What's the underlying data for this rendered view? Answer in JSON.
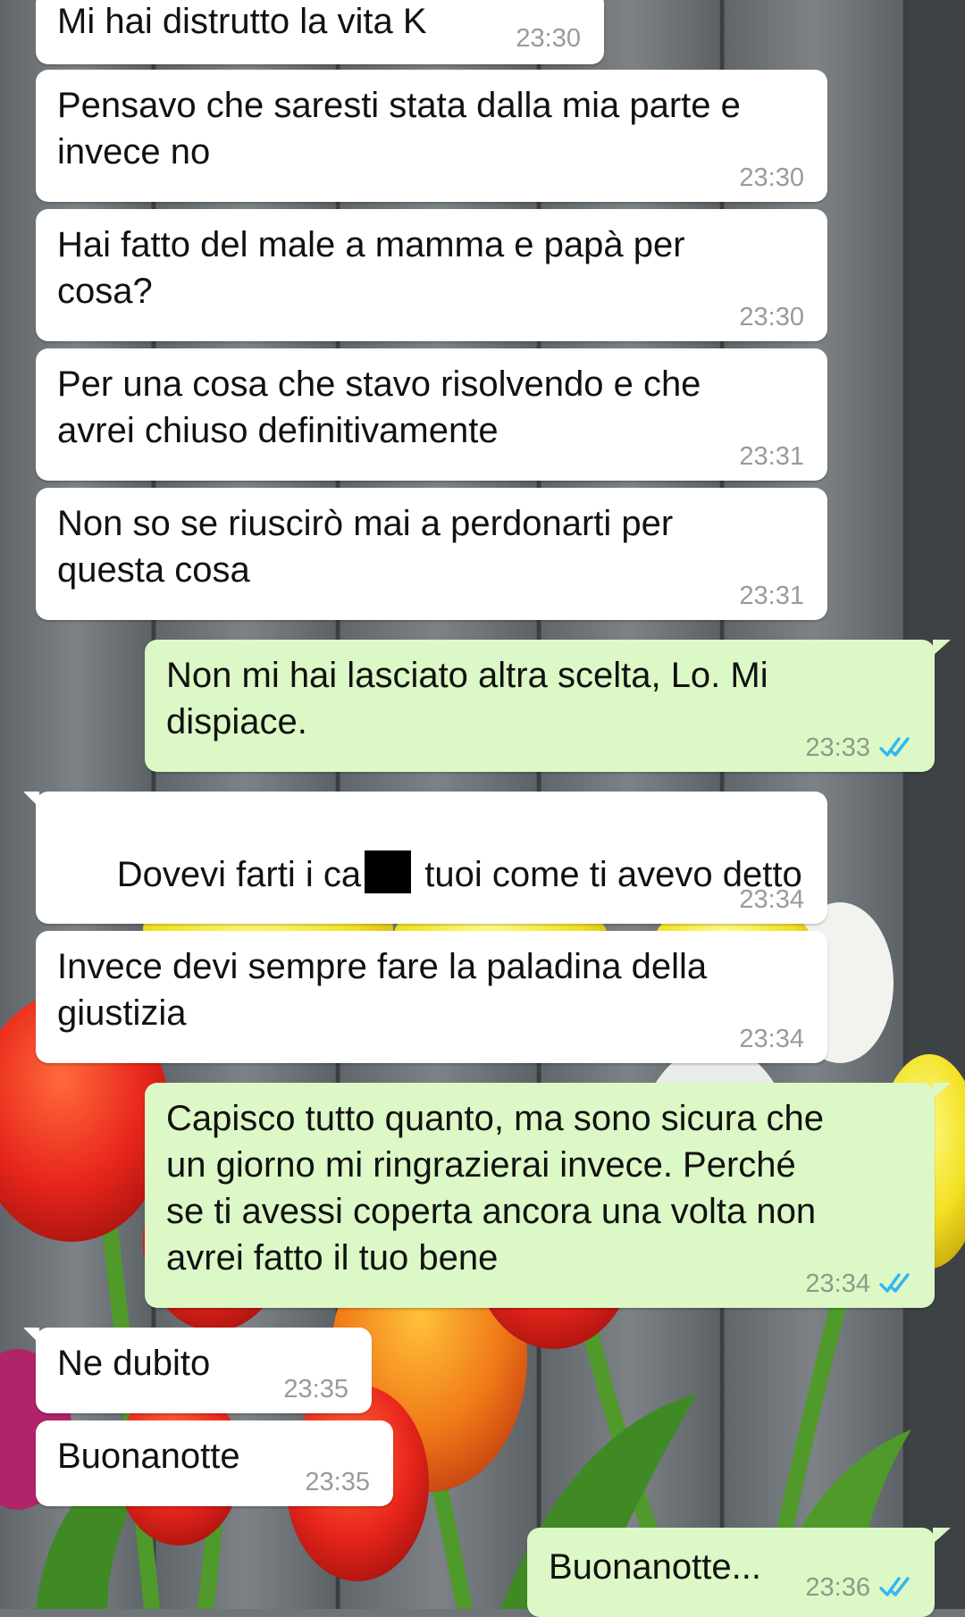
{
  "colors": {
    "incoming_bubble": "#ffffff",
    "outgoing_bubble": "#dcf8c6",
    "timestamp": "#9a9a9a",
    "read_ticks": "#34b7f1"
  },
  "messages": [
    {
      "dir": "in",
      "text": "Mi hai distrutto la vita K",
      "time": "23:30"
    },
    {
      "dir": "in",
      "text": "Pensavo che saresti stata dalla mia parte e\ninvece no",
      "time": "23:30"
    },
    {
      "dir": "in",
      "text": "Hai fatto del male a mamma e papà per\ncosa?",
      "time": "23:30"
    },
    {
      "dir": "in",
      "text": "Per una cosa che stavo risolvendo e che\navrei chiuso definitivamente",
      "time": "23:31"
    },
    {
      "dir": "in",
      "text": "Non so se riuscirò mai a perdonarti per\nquesta cosa",
      "time": "23:31"
    },
    {
      "dir": "out",
      "text": "Non mi hai lasciato altra scelta, Lo. Mi\ndispiace.",
      "time": "23:33",
      "status_icon": "double-check-read-icon"
    },
    {
      "dir": "in",
      "text_before": "Dovevi farti i ca",
      "text_after": " tuoi come ti avevo detto",
      "time": "23:34"
    },
    {
      "dir": "in",
      "text": "Invece devi sempre fare la paladina della\ngiustizia",
      "time": "23:34"
    },
    {
      "dir": "out",
      "text": "Capisco tutto quanto, ma sono sicura che\nun giorno mi ringrazierai invece. Perché\nse ti avessi coperta ancora una volta non\navrei fatto il tuo bene",
      "time": "23:34",
      "status_icon": "double-check-read-icon"
    },
    {
      "dir": "in",
      "text": "Ne dubito",
      "time": "23:35"
    },
    {
      "dir": "in",
      "text": "Buonanotte",
      "time": "23:35"
    },
    {
      "dir": "out",
      "text": "Buonanotte...",
      "time": "23:36",
      "status_icon": "double-check-read-icon"
    }
  ]
}
